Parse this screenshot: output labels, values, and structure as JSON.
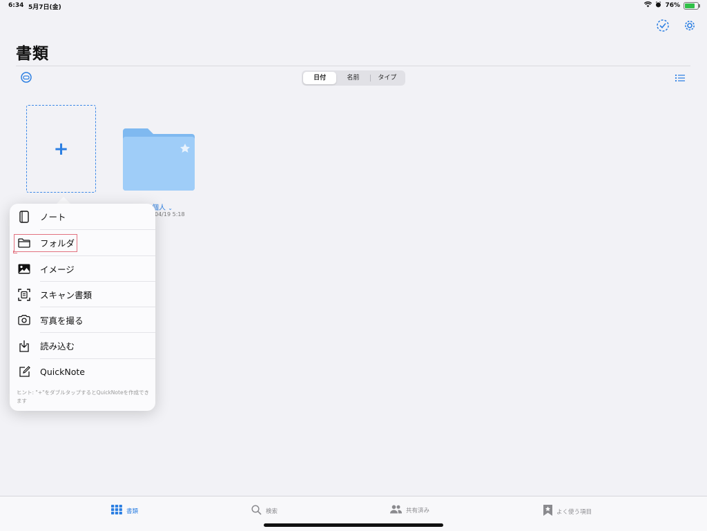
{
  "status_bar": {
    "time": "6:34",
    "date": "5月7日(金)",
    "battery": "76%",
    "battery_level": 0.76
  },
  "header": {
    "title": "書類"
  },
  "sort_control": {
    "options": [
      "日付",
      "名前",
      "タイプ"
    ],
    "selected": "日付"
  },
  "folder": {
    "name": "個人",
    "date": "04/19 5:18"
  },
  "menu": {
    "items": [
      {
        "label": "ノート",
        "icon": "notebook-icon"
      },
      {
        "label": "フォルダ",
        "icon": "folder-icon"
      },
      {
        "label": "イメージ",
        "icon": "image-icon"
      },
      {
        "label": "スキャン書類",
        "icon": "scan-document-icon"
      },
      {
        "label": "写真を撮る",
        "icon": "camera-icon"
      },
      {
        "label": "読み込む",
        "icon": "import-icon"
      },
      {
        "label": "QuickNote",
        "icon": "quicknote-icon"
      }
    ],
    "hint": "ヒント: \"+\"をダブルタップするとQuickNoteを作成できます"
  },
  "tabbar": {
    "tabs": [
      {
        "label": "書類",
        "icon": "grid-icon",
        "active": true
      },
      {
        "label": "検索",
        "icon": "search-icon",
        "active": false
      },
      {
        "label": "共有済み",
        "icon": "people-icon",
        "active": false
      },
      {
        "label": "よく使う項目",
        "icon": "bookmark-star-icon",
        "active": false
      }
    ]
  },
  "colors": {
    "accent": "#2c7fe2",
    "background": "#f2f2f6",
    "folder": "#8ec3f5",
    "highlight": "#e2707e"
  }
}
